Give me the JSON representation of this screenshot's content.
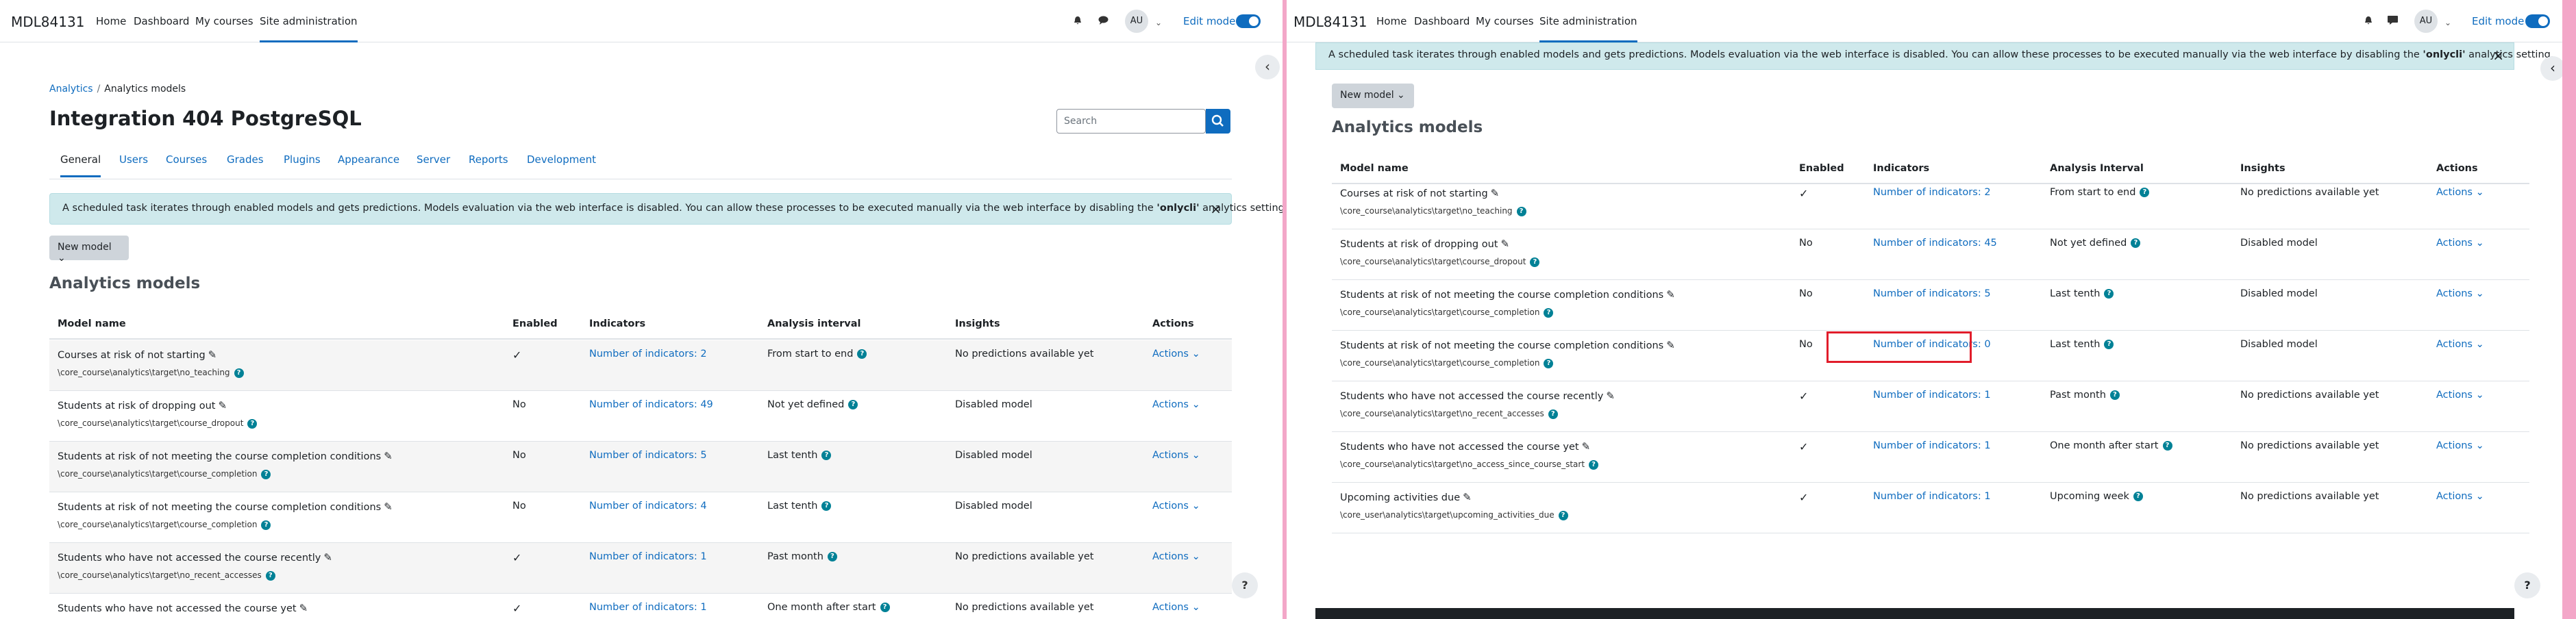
{
  "site": {
    "name": "MDL84131",
    "nav": [
      "Home",
      "Dashboard",
      "My courses",
      "Site administration"
    ],
    "active_nav": "Site administration",
    "user_initials": "AU",
    "edit_mode_label": "Edit mode"
  },
  "left": {
    "breadcrumb": [
      "Analytics",
      "Analytics models"
    ],
    "page_title": "Integration 404 PostgreSQL",
    "search_placeholder": "Search",
    "tabs": [
      "General",
      "Users",
      "Courses",
      "Grades",
      "Plugins",
      "Appearance",
      "Server",
      "Reports",
      "Development"
    ],
    "active_tab": "General",
    "alert_text_before": "A scheduled task iterates through enabled models and gets predictions. Models evaluation via the web interface is disabled. You can allow these processes to be executed manually via the web interface by disabling the ",
    "alert_bold": "'onlycli'",
    "alert_text_after": " analytics setting.",
    "new_model_label": "New model",
    "section_title": "Analytics models",
    "columns": [
      "Model name",
      "Enabled",
      "Indicators",
      "Analysis interval",
      "Insights",
      "Actions"
    ],
    "rows": [
      {
        "name": "Courses at risk of not starting",
        "target": "\\core_course\\analytics\\target\\no_teaching",
        "enabled": "✓",
        "indicators": "Number of indicators: 2",
        "interval": "From start to end",
        "insights": "No predictions available yet",
        "actions": "Actions"
      },
      {
        "name": "Students at risk of dropping out",
        "target": "\\core_course\\analytics\\target\\course_dropout",
        "enabled": "No",
        "indicators": "Number of indicators: 49",
        "interval": "Not yet defined",
        "insights": "Disabled model",
        "actions": "Actions"
      },
      {
        "name": "Students at risk of not meeting the course completion conditions",
        "target": "\\core_course\\analytics\\target\\course_completion",
        "enabled": "No",
        "indicators": "Number of indicators: 5",
        "interval": "Last tenth",
        "insights": "Disabled model",
        "actions": "Actions"
      },
      {
        "name": "Students at risk of not meeting the course completion conditions",
        "target": "\\core_course\\analytics\\target\\course_completion",
        "enabled": "No",
        "indicators": "Number of indicators: 4",
        "interval": "Last tenth",
        "insights": "Disabled model",
        "actions": "Actions"
      },
      {
        "name": "Students who have not accessed the course recently",
        "target": "\\core_course\\analytics\\target\\no_recent_accesses",
        "enabled": "✓",
        "indicators": "Number of indicators: 1",
        "interval": "Past month",
        "insights": "No predictions available yet",
        "actions": "Actions"
      },
      {
        "name": "Students who have not accessed the course yet",
        "target": "",
        "enabled": "✓",
        "indicators": "Number of indicators: 1",
        "interval": "One month after start",
        "insights": "No predictions available yet",
        "actions": "Actions"
      }
    ]
  },
  "right": {
    "alert_text_before": "A scheduled task iterates through enabled models and gets predictions. Models evaluation via the web interface is disabled. You can allow these processes to be executed manually via the web interface by disabling the ",
    "alert_bold": "'onlycli'",
    "alert_text_after": " analytics setting.",
    "new_model_label": "New model",
    "section_title": "Analytics models",
    "columns": [
      "Model name",
      "Enabled",
      "Indicators",
      "Analysis Interval",
      "Insights",
      "Actions"
    ],
    "rows": [
      {
        "name": "Courses at risk of not starting",
        "target": "\\core_course\\analytics\\target\\no_teaching",
        "enabled": "✓",
        "indicators": "Number of indicators: 2",
        "interval": "From start to end",
        "insights": "No predictions available yet",
        "actions": "Actions"
      },
      {
        "name": "Students at risk of dropping out",
        "target": "\\core_course\\analytics\\target\\course_dropout",
        "enabled": "No",
        "indicators": "Number of indicators: 45",
        "interval": "Not yet defined",
        "insights": "Disabled model",
        "actions": "Actions"
      },
      {
        "name": "Students at risk of not meeting the course completion conditions",
        "target": "\\core_course\\analytics\\target\\course_completion",
        "enabled": "No",
        "indicators": "Number of indicators: 5",
        "interval": "Last tenth",
        "insights": "Disabled model",
        "actions": "Actions"
      },
      {
        "name": "Students at risk of not meeting the course completion conditions",
        "target": "\\core_course\\analytics\\target\\course_completion",
        "enabled": "No",
        "indicators": "Number of indicators: 0",
        "interval": "Last tenth",
        "insights": "Disabled model",
        "actions": "Actions"
      },
      {
        "name": "Students who have not accessed the course recently",
        "target": "\\core_course\\analytics\\target\\no_recent_accesses",
        "enabled": "✓",
        "indicators": "Number of indicators: 1",
        "interval": "Past month",
        "insights": "No predictions available yet",
        "actions": "Actions"
      },
      {
        "name": "Students who have not accessed the course yet",
        "target": "\\core_course\\analytics\\target\\no_access_since_course_start",
        "enabled": "✓",
        "indicators": "Number of indicators: 1",
        "interval": "One month after start",
        "insights": "No predictions available yet",
        "actions": "Actions"
      },
      {
        "name": "Upcoming activities due",
        "target": "\\core_user\\analytics\\target\\upcoming_activities_due",
        "enabled": "✓",
        "indicators": "Number of indicators: 1",
        "interval": "Upcoming week",
        "insights": "No predictions available yet",
        "actions": "Actions"
      }
    ]
  }
}
